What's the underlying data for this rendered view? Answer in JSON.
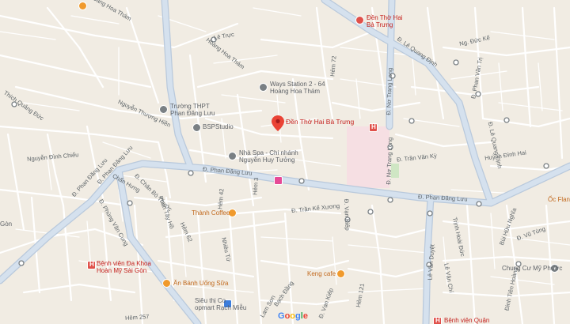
{
  "map": {
    "selected_place": "Đền Thờ Hai Bà Trưng",
    "logo": {
      "text": "Google",
      "colors": [
        "#4285F4",
        "#EA4335",
        "#FBBC05",
        "#4285F4",
        "#34A853",
        "#EA4335"
      ]
    },
    "colors": {
      "land": "#f1ece3",
      "minor_road": "#ffffff",
      "major_road": "#c9d8ea",
      "hospital_zone": "#f6dfe3",
      "park": "#cfe6c4"
    }
  },
  "roads": [
    {
      "id": "phan-dang-luu-west",
      "text": "Đ. Phan Đăng Lưu"
    },
    {
      "id": "phan-dang-luu-mid",
      "text": "Đ. Phan Đăng Lưu"
    },
    {
      "id": "phan-dang-luu-east",
      "text": "Đ. Phan Đăng Lưu"
    },
    {
      "id": "hoang-hoa-tham-top",
      "text": "Hoàng Hoa Thám"
    },
    {
      "id": "hoang-hoa-tham-mid",
      "text": "Hoàng Hoa Thám"
    },
    {
      "id": "thich-quang-duc",
      "text": "Thích Quảng Đức"
    },
    {
      "id": "nguyen-thuong-hien",
      "text": "Nguyễn Thượng Hiền"
    },
    {
      "id": "nguyen-dinh-chieu",
      "text": "Nguyễn Đình Chiểu"
    },
    {
      "id": "phan-dang-luu-left",
      "text": "Đ. Phan Đăng Lưu"
    },
    {
      "id": "chan-hung",
      "text": "Chấn Hưng"
    },
    {
      "id": "chan-bo-thuoc",
      "text": "Đ. Chân Bò Thước"
    },
    {
      "id": "phan-tay-ho",
      "text": "Phan Tây Hồ"
    },
    {
      "id": "phung-van-cung",
      "text": "Đ. Phùng Văn Cung"
    },
    {
      "id": "tran-ke-xuong",
      "text": "Đ. Trần Kế Xương"
    },
    {
      "id": "van-kiep-left",
      "text": "Đ. Vạn Kiếp"
    },
    {
      "id": "van-kiep-right",
      "text": "Đ. Vạn Kiếp"
    },
    {
      "id": "no-trang-long",
      "text": "Đ. Nơ Trang Long"
    },
    {
      "id": "tran-van-ky",
      "text": "Đ. Trần Văn Kỳ"
    },
    {
      "id": "le-quang-dinh-top",
      "text": "Đ. Lê Quang Định"
    },
    {
      "id": "le-quang-dinh-mid",
      "text": "Đ. Lê Quang Định"
    },
    {
      "id": "huynh-dinh-hai",
      "text": "Huỳnh Đình Hai"
    },
    {
      "id": "ngo-duc-ke",
      "text": "Ng. Đức Kế"
    },
    {
      "id": "phan-van-tri",
      "text": "Đ. Phan Văn Trị"
    },
    {
      "id": "le-van-duyet",
      "text": "Lê Văn Duyệt"
    },
    {
      "id": "trinh-hoai-duc",
      "text": "Trịnh Hoài Đức"
    },
    {
      "id": "bui-huu-nghia",
      "text": "Bùi Hữu Nghĩa"
    },
    {
      "id": "vu-tung",
      "text": "Đ. Vũ Tùng"
    },
    {
      "id": "le-van-chi",
      "text": "Lê Văn Chí"
    },
    {
      "id": "dinh-tien-hoang",
      "text": "Đinh Tiên Hoàng"
    },
    {
      "id": "hem-257",
      "text": "Hẻm 257"
    },
    {
      "id": "hem-left",
      "text": "Hẻm 3"
    },
    {
      "id": "nhieu-tu",
      "text": "Nhiêu Tứ"
    },
    {
      "id": "hem-72",
      "text": "Hẻm 72"
    },
    {
      "id": "le-truc",
      "text": "Lê Trực"
    },
    {
      "id": "hem-top",
      "text": "Hẻm 42"
    },
    {
      "id": "lam-van-ben",
      "text": "Lam Sơn"
    },
    {
      "id": "bach-dang",
      "text": "Bạch Đằng"
    },
    {
      "id": "hem-mid",
      "text": "Hẻm 62"
    },
    {
      "id": "no-trang-long-top",
      "text": "Đ. Nơ Trang Long"
    },
    {
      "id": "nguyen-van-dau",
      "text": "Hẻm 121"
    }
  ],
  "pois": [
    {
      "id": "den-tho-hai-ba-trung-top",
      "name": "Đền Thờ Hai\nBà Trưng",
      "kind": "red"
    },
    {
      "id": "den-tho-hai-ba-trung-main",
      "name": "Đền Thờ Hai Bà Trưng",
      "kind": "red"
    },
    {
      "id": "ways-station",
      "name": "Ways Station 2 - 64\nHoàng Hoa Thám",
      "kind": "gray"
    },
    {
      "id": "truong-thpt",
      "name": "Trường THPT\nPhan Đăng Lưu",
      "kind": "gray"
    },
    {
      "id": "bspstudio",
      "name": "BSPStudio",
      "kind": "gray"
    },
    {
      "id": "nha-spa",
      "name": "Nhà Spa - Chi nhánh\nNguyễn Huy Tưởng",
      "kind": "gray"
    },
    {
      "id": "thanh-coffee",
      "name": "Thành Coffee",
      "kind": "orange"
    },
    {
      "id": "benh-vien-da-khoa",
      "name": "Bệnh viện Đa Khoa\nHoàn Mỹ Sài Gòn",
      "kind": "red"
    },
    {
      "id": "an-banh-uong-sua",
      "name": "Ăn Bánh Uống Sữa",
      "kind": "orange"
    },
    {
      "id": "keng-cafe",
      "name": "Keng cafe",
      "kind": "orange"
    },
    {
      "id": "sieu-thi-co-op",
      "name": "Siêu thị Co\nopmart Rạch Miễu",
      "kind": "blue"
    },
    {
      "id": "chung-cu-my-phuoc",
      "name": "Chung Cư Mỹ Phước",
      "kind": "gray"
    },
    {
      "id": "oc-flan",
      "name": "Ốc Flan",
      "kind": "orange"
    },
    {
      "id": "benh-vien-quan",
      "name": "Bệnh viện Quận",
      "kind": "red"
    },
    {
      "id": "gon",
      "name": "Gòn",
      "kind": "gray"
    }
  ]
}
